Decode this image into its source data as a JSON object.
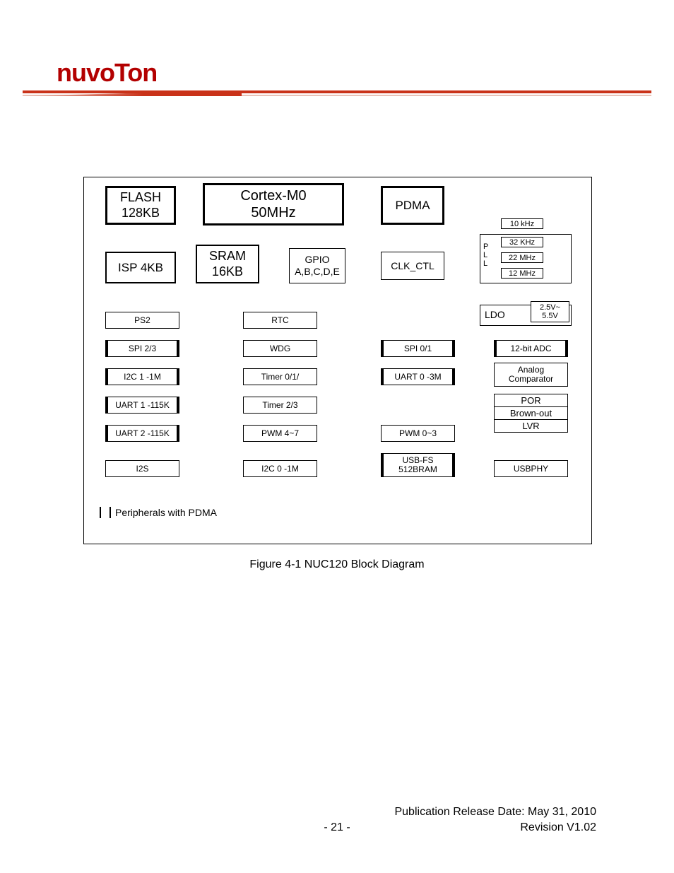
{
  "brand": "nuvoTon",
  "caption": "Figure 4-1 NUC120 Block Diagram",
  "footer": {
    "publication": "Publication Release Date: May 31, 2010",
    "revision": "Revision V1.02",
    "page": "- 21 -"
  },
  "legend": "Peripherals with PDMA",
  "blocks": {
    "flash": {
      "l1": "FLASH",
      "l2": "128KB"
    },
    "isp": "ISP 4KB",
    "cortex": {
      "l1": "Cortex-M0",
      "l2": "50MHz"
    },
    "sram": {
      "l1": "SRAM",
      "l2": "16KB"
    },
    "gpio": {
      "l1": "GPIO",
      "l2": "A,B,C,D,E"
    },
    "pdma": "PDMA",
    "clkctl": "CLK_CTL",
    "pll_label": "P\nL\nL",
    "pll_opts": [
      "10 kHz",
      "32 KHz",
      "22 MHz",
      "12 MHz"
    ],
    "ldo": "LDO",
    "ldo_v": "2.5V~\n5.5V",
    "col1": [
      "PS2",
      "SPI 2/3",
      "I2C 1 -1M",
      "UART 1 -115K",
      "UART 2 -115K",
      "I2S"
    ],
    "col2": [
      "RTC",
      "WDG",
      "Timer 0/1/",
      "Timer 2/3",
      "PWM 4~7",
      "I2C 0 -1M"
    ],
    "col3": [
      "",
      "SPI 0/1",
      "UART 0 -3M",
      "",
      "PWM 0~3",
      "USB-FS\n512BRAM"
    ],
    "col4_adc": "12-bit ADC",
    "col4_acmp": "Analog\nComparator",
    "col4_stack": [
      "POR",
      "Brown-out",
      "LVR"
    ],
    "col4_usbphy": "USBPHY"
  }
}
